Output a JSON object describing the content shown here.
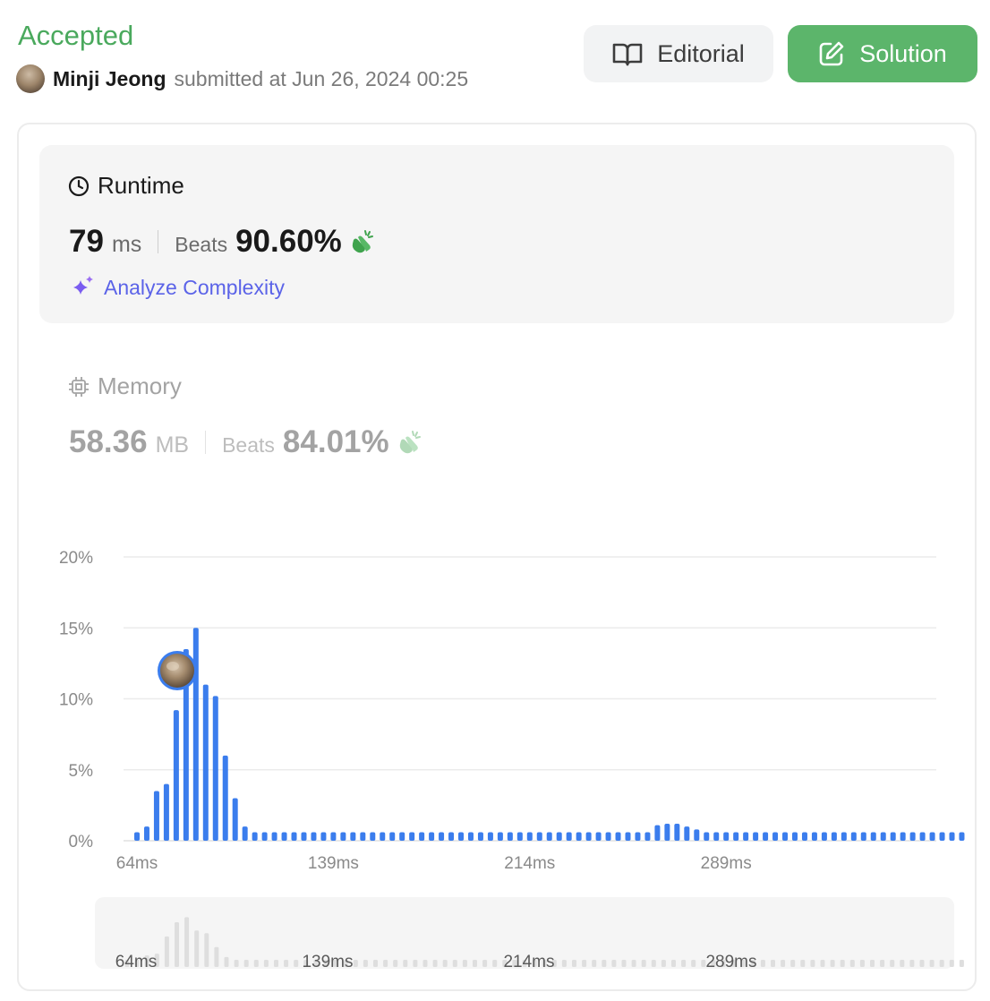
{
  "header": {
    "status": "Accepted",
    "user_name": "Minji Jeong",
    "submitted_text": "submitted at Jun 26, 2024 00:25",
    "editorial_label": "Editorial",
    "solution_label": "Solution"
  },
  "runtime": {
    "title": "Runtime",
    "value": "79",
    "unit": "ms",
    "beats_label": "Beats",
    "beats_pct": "90.60%",
    "analyze_label": "Analyze Complexity"
  },
  "memory": {
    "title": "Memory",
    "value": "58.36",
    "unit": "MB",
    "beats_label": "Beats",
    "beats_pct": "84.01%"
  },
  "colors": {
    "accepted": "#4aa95d",
    "solution_button": "#5cb56b",
    "bar": "#3b7ded",
    "analyze": "#5b63e8",
    "mini_bar": "#dedede"
  },
  "chart_data": {
    "type": "bar",
    "xlabel": "",
    "ylabel": "",
    "ylim": [
      0,
      20
    ],
    "y_ticks": [
      "0%",
      "5%",
      "10%",
      "15%",
      "20%"
    ],
    "x_ticks": [
      "64ms",
      "139ms",
      "214ms",
      "289ms"
    ],
    "grid": true,
    "user_marker_index": 6,
    "values": [
      0.6,
      1.0,
      3.5,
      4.0,
      9.2,
      13.5,
      15.0,
      11.0,
      10.2,
      6.0,
      3.0,
      1.0,
      0.6,
      0.6,
      0.6,
      0.6,
      0.6,
      0.6,
      0.6,
      0.6,
      0.6,
      0.6,
      0.6,
      0.6,
      0.6,
      0.6,
      0.6,
      0.6,
      0.6,
      0.6,
      0.6,
      0.6,
      0.6,
      0.6,
      0.6,
      0.6,
      0.6,
      0.6,
      0.6,
      0.6,
      0.6,
      0.6,
      0.6,
      0.6,
      0.6,
      0.6,
      0.6,
      0.6,
      0.6,
      0.6,
      0.6,
      0.6,
      0.6,
      1.1,
      1.2,
      1.2,
      1.0,
      0.8,
      0.6,
      0.6,
      0.6,
      0.6,
      0.6,
      0.6,
      0.6,
      0.6,
      0.6,
      0.6,
      0.6,
      0.6,
      0.6,
      0.6,
      0.6,
      0.6,
      0.6,
      0.6,
      0.6,
      0.6,
      0.6,
      0.6,
      0.6,
      0.6,
      0.6,
      0.6,
      0.6
    ]
  }
}
